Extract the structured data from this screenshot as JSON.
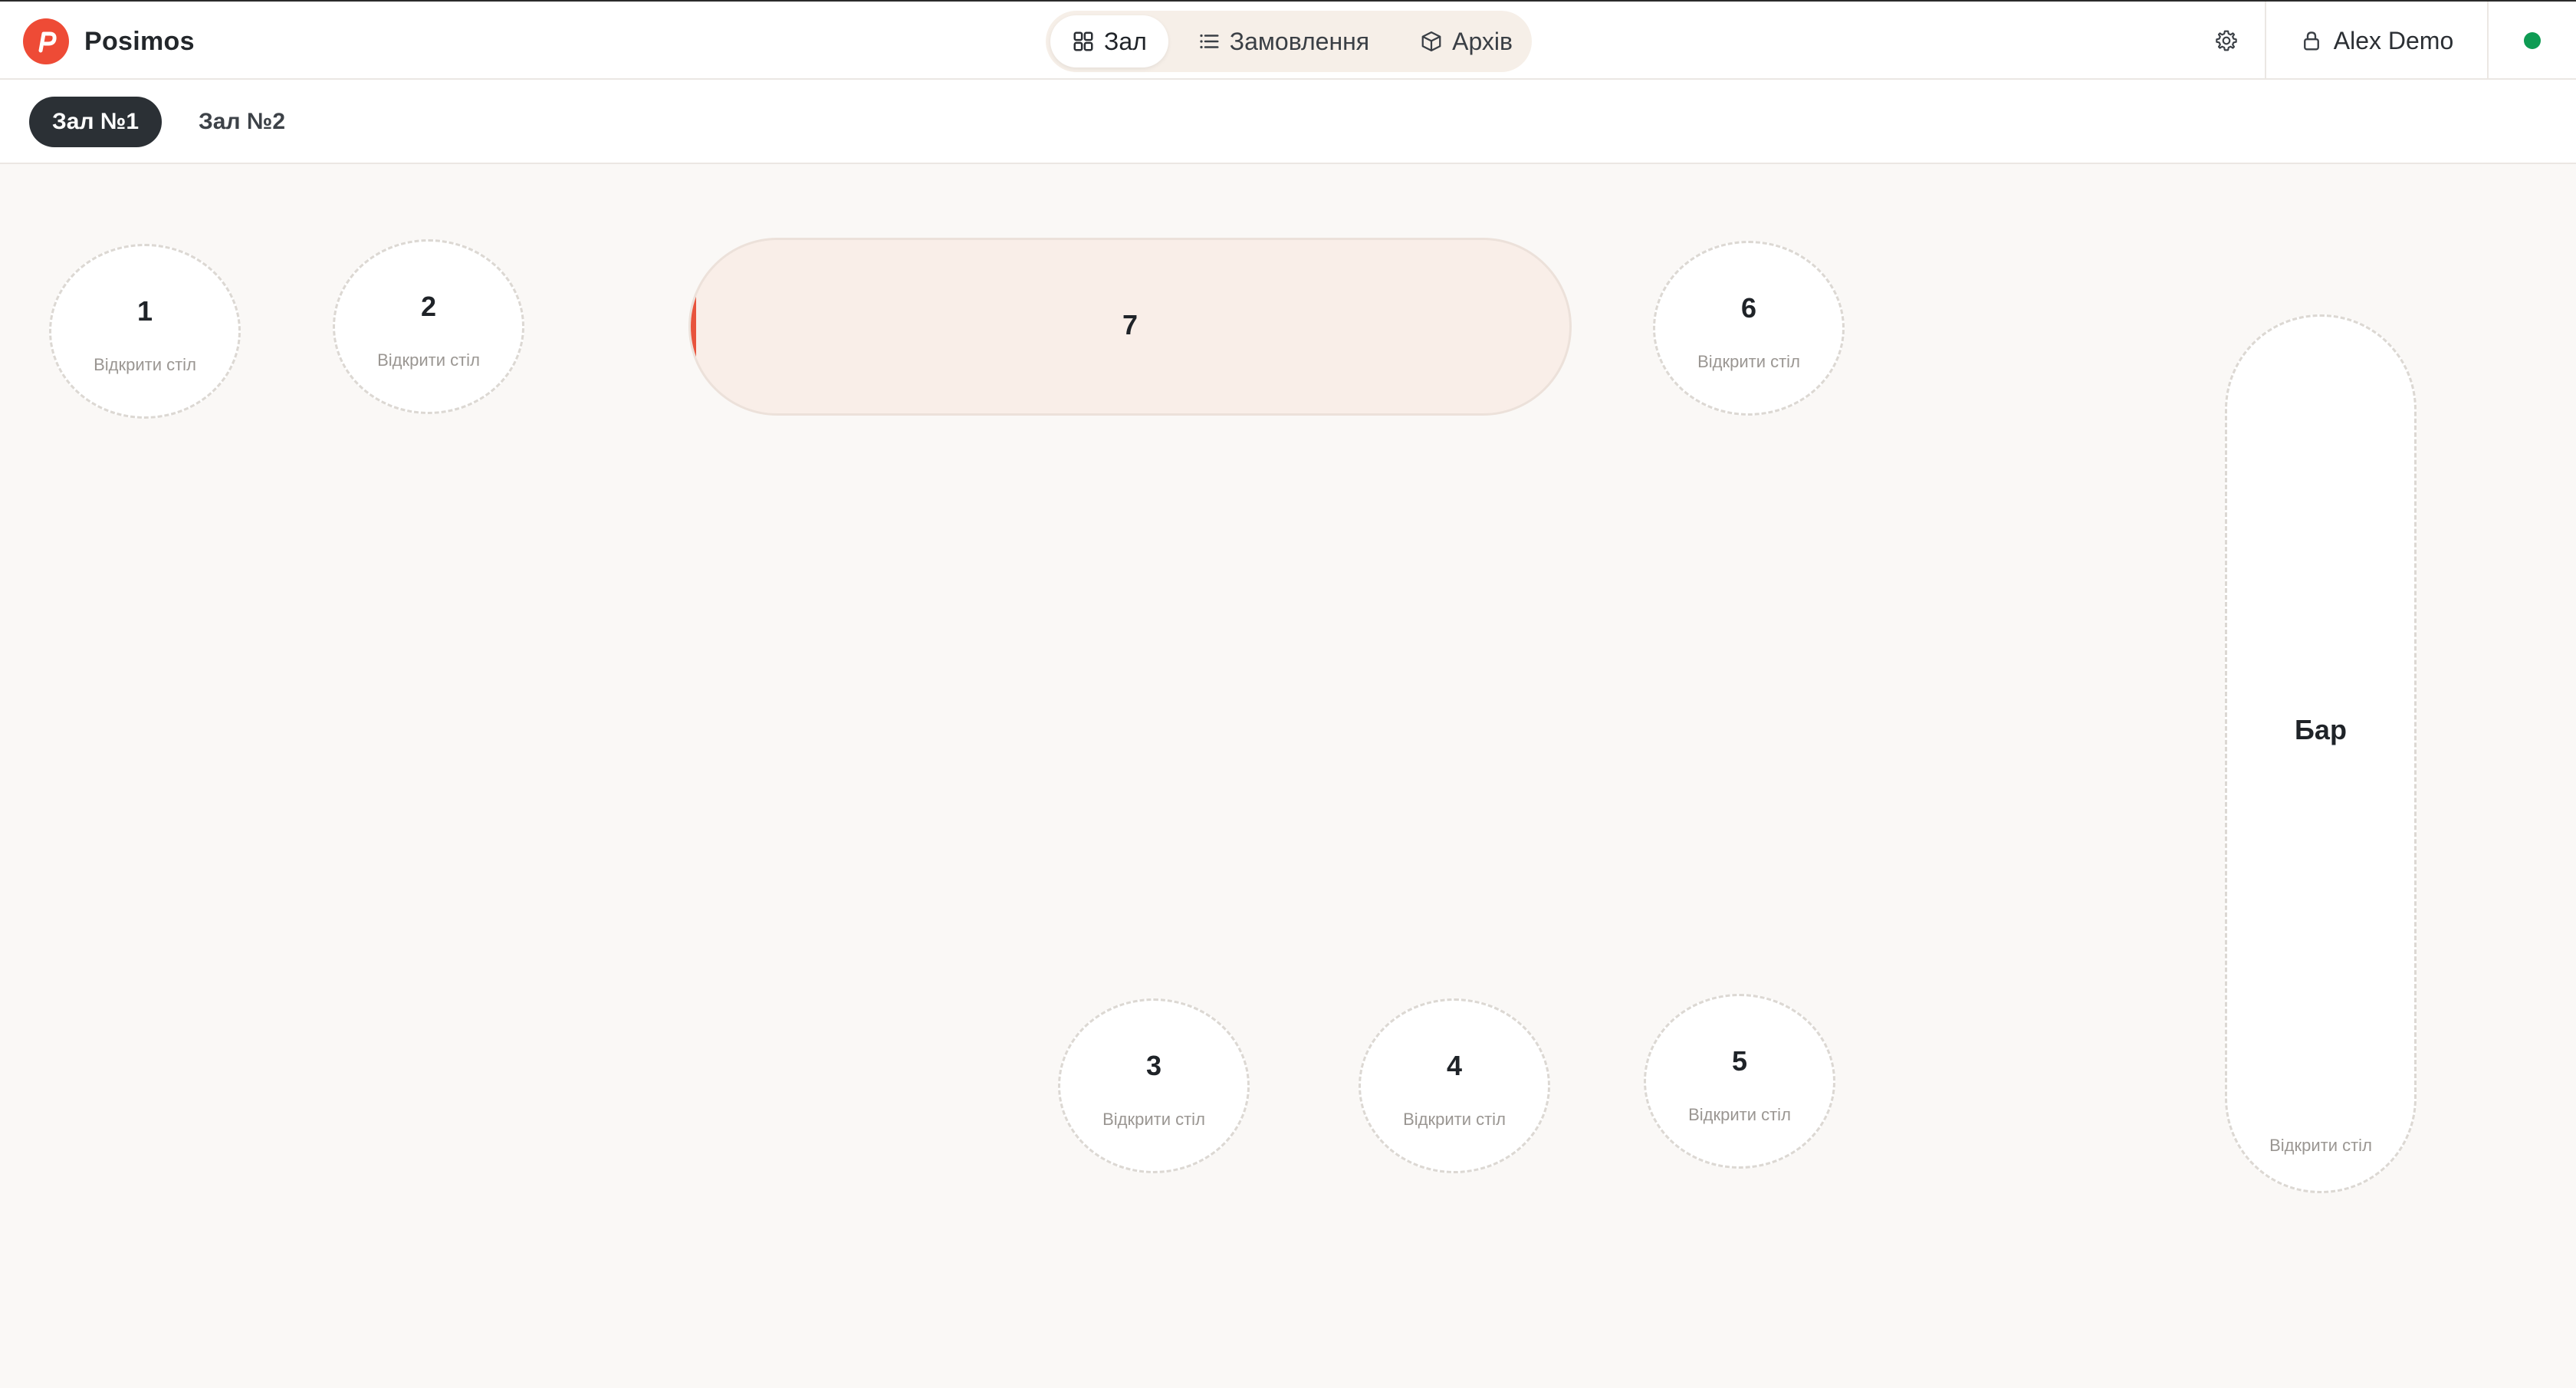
{
  "app": {
    "name": "Posimos",
    "logo_letter": "P",
    "brand_color": "#ee4b36"
  },
  "nav": {
    "tabs": [
      {
        "label": "Зал",
        "icon": "grid-icon",
        "active": true
      },
      {
        "label": "Замовлення",
        "icon": "list-icon",
        "active": false
      },
      {
        "label": "Архів",
        "icon": "box-icon",
        "active": false
      }
    ]
  },
  "user": {
    "name": "Alex Demo",
    "icon": "lock-icon"
  },
  "status": {
    "online": true,
    "color": "#0e9b53"
  },
  "halls": [
    {
      "label": "Зал №1",
      "active": true
    },
    {
      "label": "Зал №2",
      "active": false
    }
  ],
  "floor": {
    "tables": [
      {
        "number": "1",
        "hint": "Відкрити стіл",
        "occupied": false
      },
      {
        "number": "2",
        "hint": "Відкрити стіл",
        "occupied": false
      },
      {
        "number": "7",
        "hint": "",
        "occupied": true
      },
      {
        "number": "6",
        "hint": "Відкрити стіл",
        "occupied": false
      },
      {
        "number": "3",
        "hint": "Відкрити стіл",
        "occupied": false
      },
      {
        "number": "4",
        "hint": "Відкрити стіл",
        "occupied": false
      },
      {
        "number": "5",
        "hint": "Відкрити стіл",
        "occupied": false
      },
      {
        "number": "Бар",
        "hint": "Відкрити стіл",
        "occupied": false
      }
    ]
  }
}
